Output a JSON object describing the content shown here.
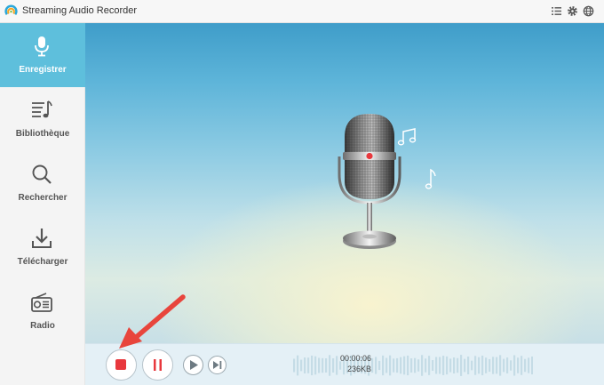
{
  "app": {
    "title": "Streaming Audio Recorder",
    "icons": [
      "list-icon",
      "gear-icon",
      "globe-icon"
    ]
  },
  "sidebar": {
    "items": [
      {
        "label": "Enregistrer",
        "icon": "microphone-icon",
        "active": true
      },
      {
        "label": "Bibliothèque",
        "icon": "music-library-icon",
        "active": false
      },
      {
        "label": "Rechercher",
        "icon": "search-icon",
        "active": false
      },
      {
        "label": "Télécharger",
        "icon": "download-icon",
        "active": false
      },
      {
        "label": "Radio",
        "icon": "radio-icon",
        "active": false
      }
    ]
  },
  "recording": {
    "elapsed": "00:00:06",
    "size": "236KB"
  },
  "controls": {
    "icons": [
      "stop-icon",
      "pause-icon",
      "play-icon",
      "next-icon"
    ]
  },
  "colors": {
    "accent": "#5ebfdc",
    "record_red": "#e8383d",
    "annotation_arrow": "#e8453c"
  }
}
